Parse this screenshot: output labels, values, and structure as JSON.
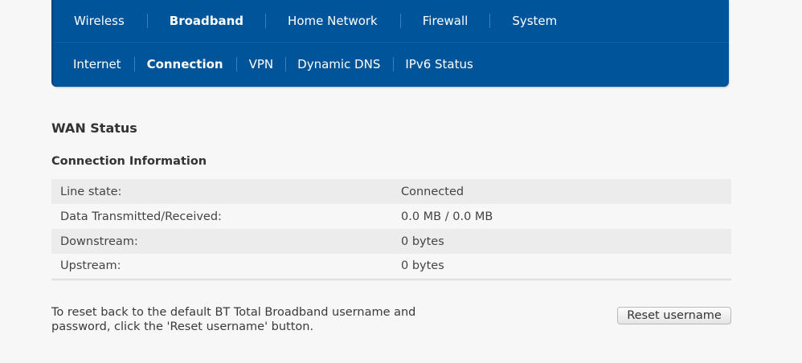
{
  "main_nav": {
    "items": [
      {
        "label": "Wireless",
        "active": false
      },
      {
        "label": "Broadband",
        "active": true
      },
      {
        "label": "Home Network",
        "active": false
      },
      {
        "label": "Firewall",
        "active": false
      },
      {
        "label": "System",
        "active": false
      }
    ]
  },
  "sub_nav": {
    "items": [
      {
        "label": "Internet",
        "active": false
      },
      {
        "label": "Connection",
        "active": true
      },
      {
        "label": "VPN",
        "active": false
      },
      {
        "label": "Dynamic DNS",
        "active": false
      },
      {
        "label": "IPv6 Status",
        "active": false
      }
    ]
  },
  "main": {
    "section_title": "WAN Status",
    "subsection_title": "Connection Information",
    "rows": [
      {
        "label": "Line state:",
        "value": "Connected"
      },
      {
        "label": "Data Transmitted/Received:",
        "value": "0.0 MB / 0.0 MB"
      },
      {
        "label": "Downstream:",
        "value": "0 bytes"
      },
      {
        "label": "Upstream:",
        "value": "0 bytes"
      }
    ],
    "reset_text": "To reset back to the default BT Total Broadband username and password, click the 'Reset username' button.",
    "reset_button_label": "Reset username"
  },
  "colors": {
    "nav_background": "#00559a",
    "page_background": "#f7f7f7",
    "row_stripe": "#ececec"
  }
}
